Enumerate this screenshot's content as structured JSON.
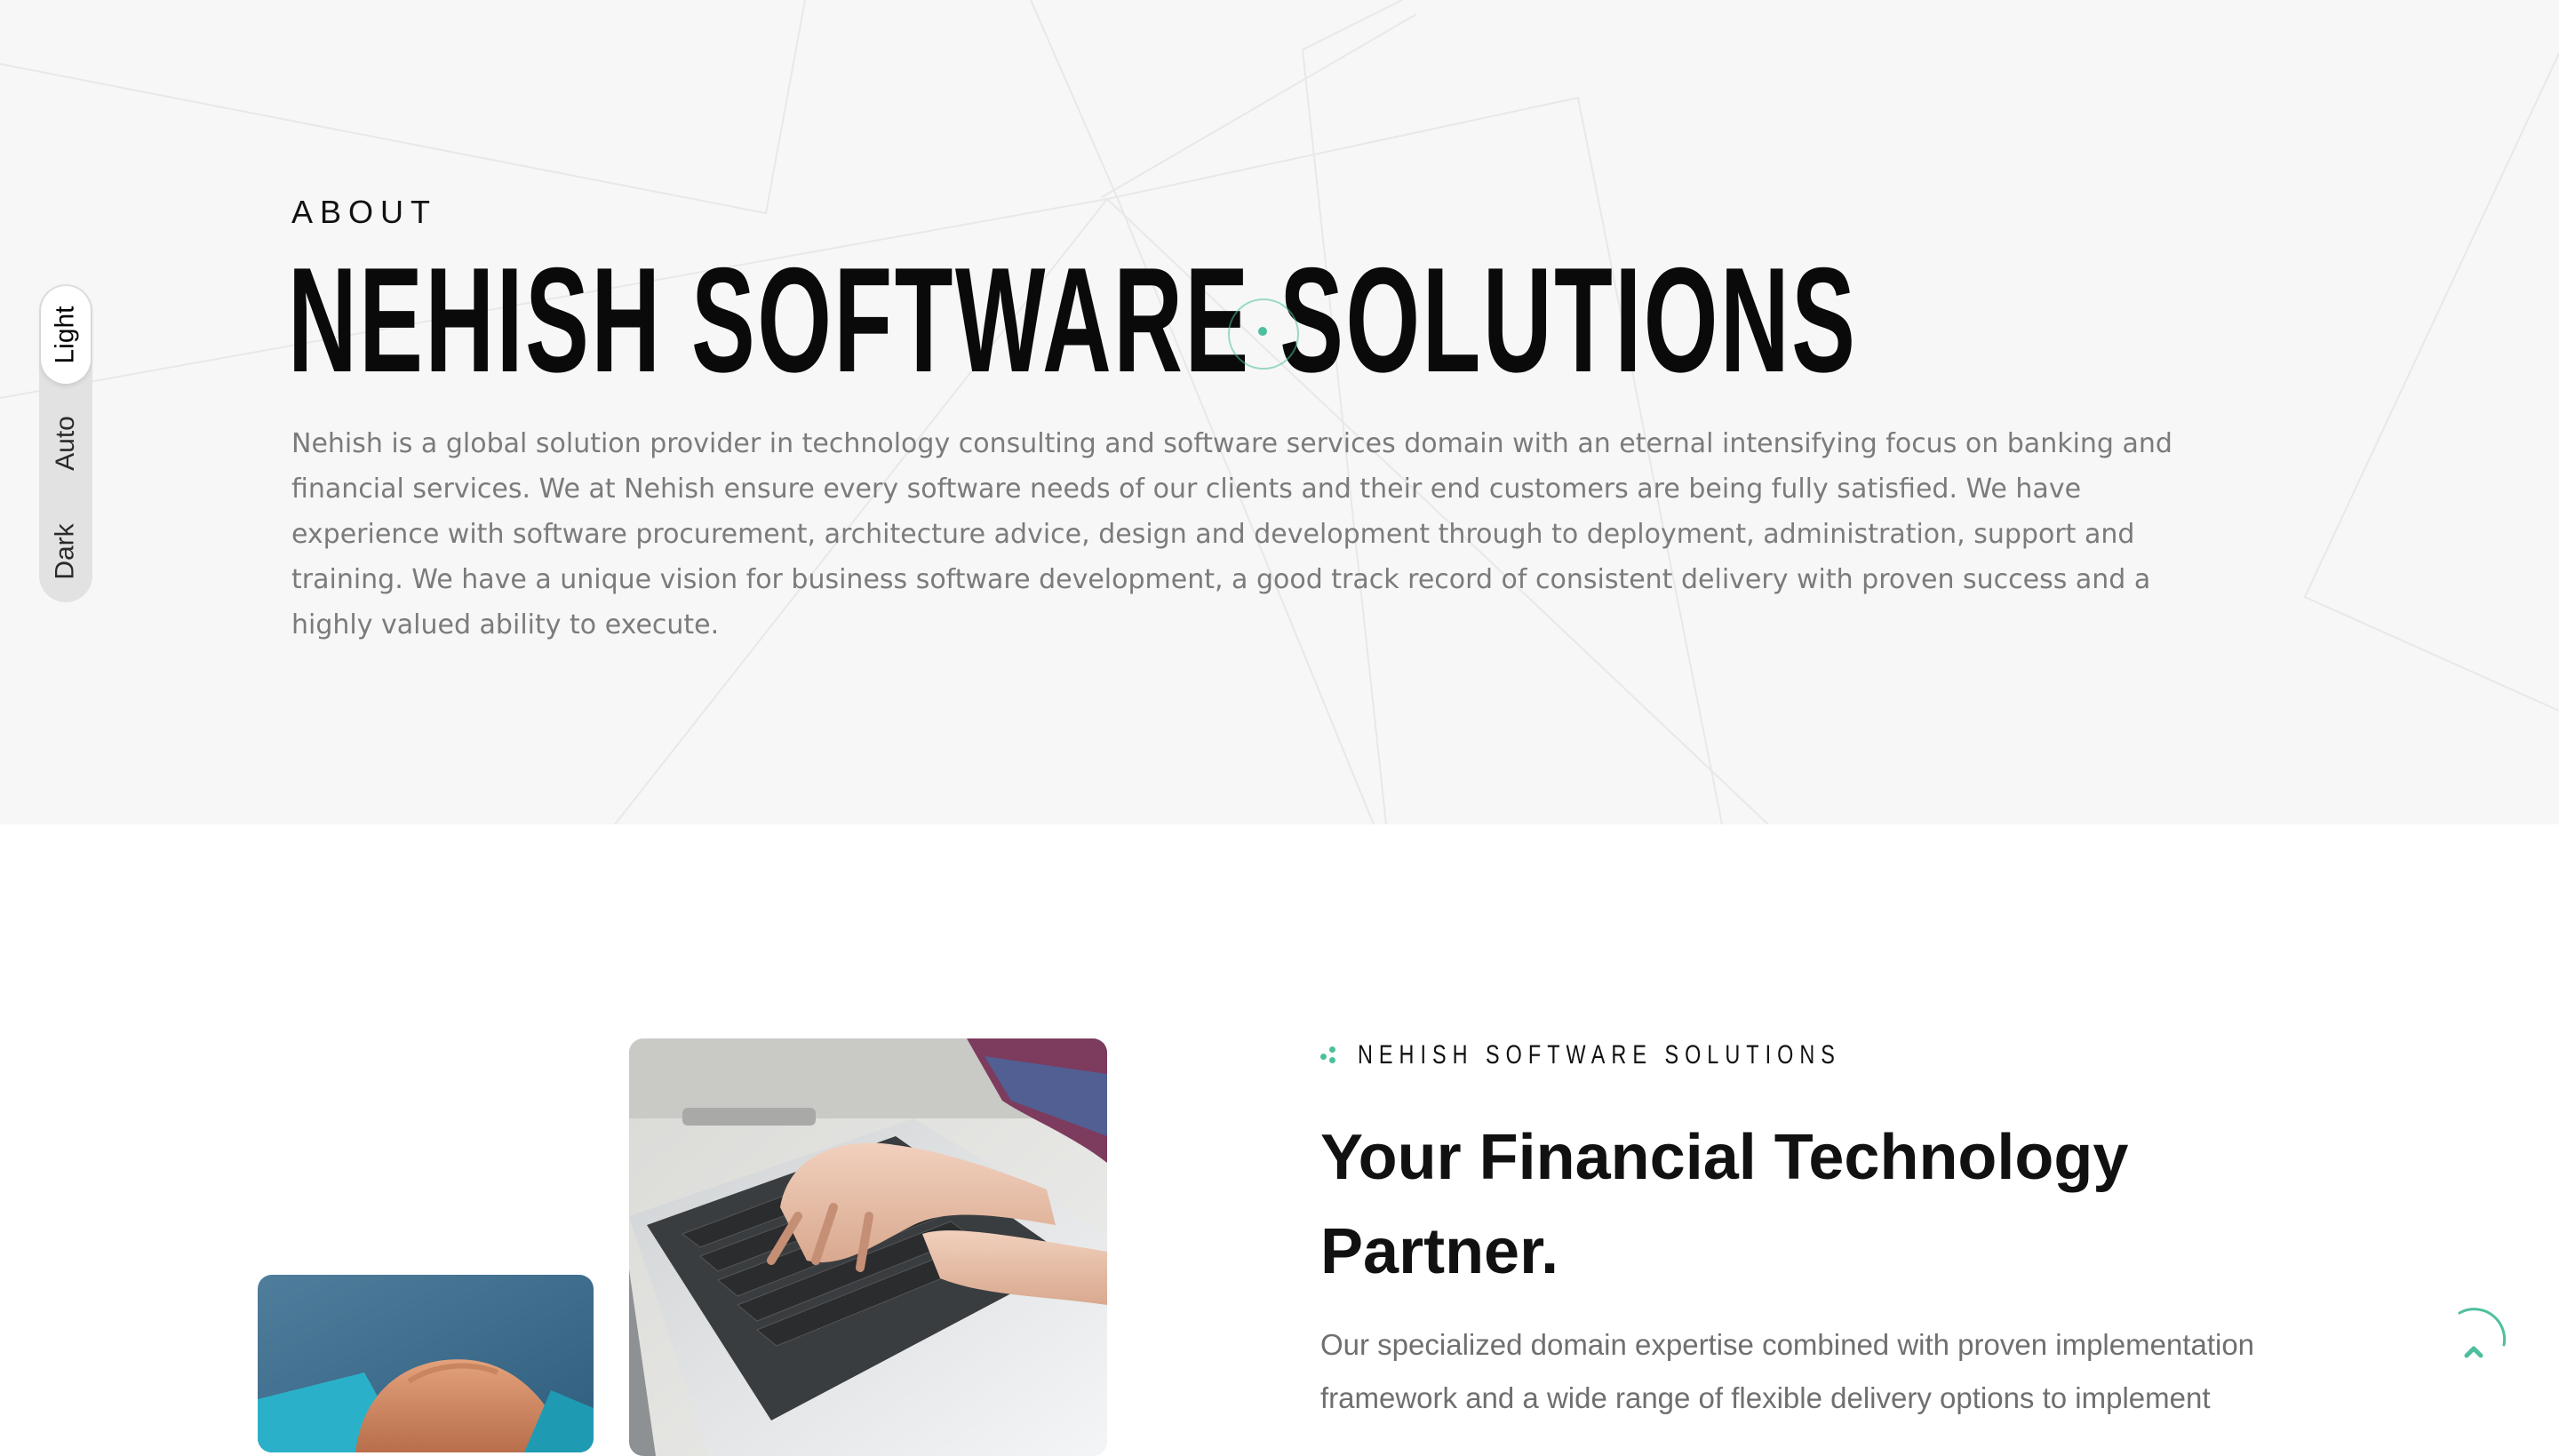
{
  "theme_switch": {
    "options": [
      "Light",
      "Auto",
      "Dark"
    ],
    "selected": "Light"
  },
  "hero": {
    "eyebrow": "ABOUT",
    "title": "NEHISH SOFTWARE SOLUTIONS",
    "description": "Nehish is a global solution provider in technology consulting and software services domain with an eternal intensifying focus on banking and financial services. We at Nehish ensure every software needs of our clients and their end customers are being fully satisfied. We have experience with software procurement, architecture advice, design and development through to deployment, administration, support and training. We have a unique vision for business software development, a good track record of consistent delivery with proven success and a highly valued ability to execute."
  },
  "about": {
    "kicker": "NEHISH SOFTWARE SOLUTIONS",
    "title": "Your Financial Technology Partner.",
    "description": "Our specialized domain expertise combined with proven implementation framework and a wide range of flexible delivery options to implement"
  },
  "colors": {
    "accent": "#4dbf9e",
    "hero_background": "#f7f7f7",
    "text_dark": "#111111",
    "text_muted": "#7b7b7b"
  },
  "icons": {
    "scroll_top": "chevron-up-icon",
    "kicker": "dots-icon"
  }
}
